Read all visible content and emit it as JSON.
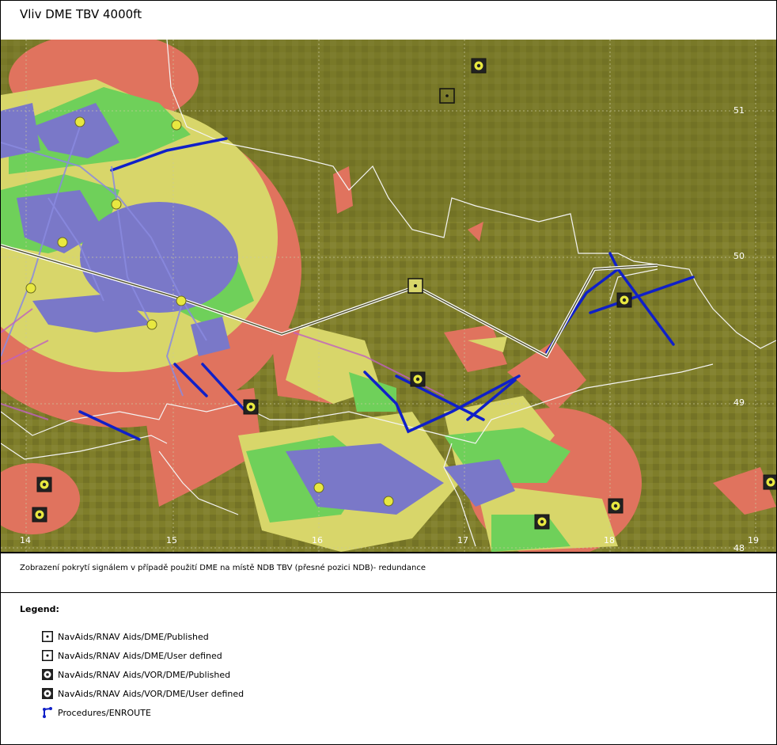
{
  "title": "Vliv DME TBV 4000ft",
  "caption": "Zobrazení pokrytí signálem v případě použití DME na místě NDB TBV (přesné pozici NDB)- redundance",
  "map": {
    "lon_labels": [
      "14",
      "15",
      "16",
      "17",
      "18",
      "19"
    ],
    "lat_labels": [
      "51",
      "50",
      "49",
      "48"
    ],
    "colors": {
      "terrain": "#7f7e2a",
      "red": "#e0735e",
      "yellow": "#d8d66a",
      "green": "#6fd05a",
      "blue": "#7a78c8",
      "route": "#1020c8",
      "border": "#f4f4f4"
    }
  },
  "legend": {
    "title": "Legend:",
    "items": [
      {
        "label": "NavAids/RNAV Aids/DME/Published",
        "icon": "dme-published-icon"
      },
      {
        "label": "NavAids/RNAV Aids/DME/User defined",
        "icon": "dme-user-defined-icon"
      },
      {
        "label": "NavAids/RNAV Aids/VOR/DME/Published",
        "icon": "vor-dme-published-icon"
      },
      {
        "label": "NavAids/RNAV Aids/VOR/DME/User defined",
        "icon": "vor-dme-user-defined-icon"
      },
      {
        "label": "Procedures/ENROUTE",
        "icon": "enroute-procedure-icon"
      }
    ]
  }
}
